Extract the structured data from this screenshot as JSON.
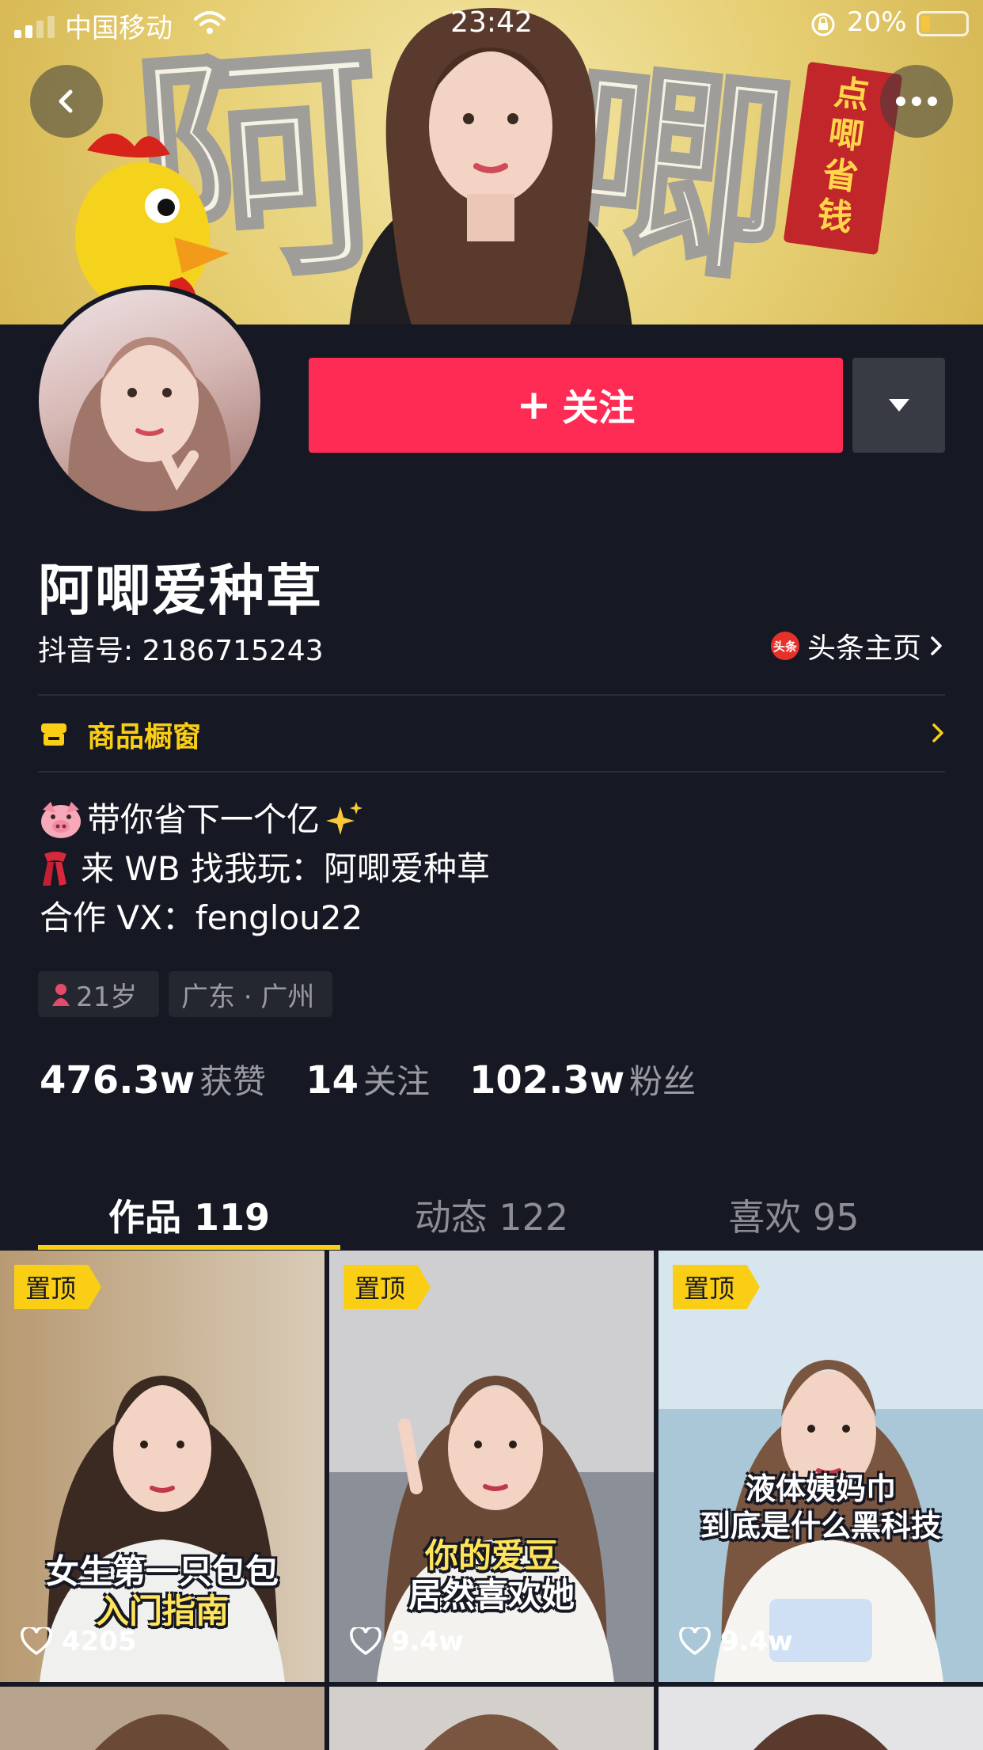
{
  "status_bar": {
    "carrier": "中国移动",
    "time": "23:42",
    "battery": "20%",
    "battery_level": 0.2
  },
  "banner": {
    "chars": [
      "阿",
      "唧"
    ],
    "tag_text": "点唧省钱"
  },
  "profile": {
    "name": "阿唧爱种草",
    "douyin_id": "抖音号: 2186715243",
    "toutiao_label": "头条主页",
    "toutiao_icon_text": "头条",
    "follow_label": "关注",
    "shop_label": "商品橱窗"
  },
  "bio": {
    "line1": "带你省下一个亿",
    "line2": "来 WB 找我玩：阿唧爱种草",
    "line3": "合作 VX：fenglou22"
  },
  "tags": {
    "age": "21岁",
    "location": "广东 · 广州"
  },
  "stats": [
    {
      "value": "476.3w",
      "label": "获赞"
    },
    {
      "value": "14",
      "label": "关注"
    },
    {
      "value": "102.3w",
      "label": "粉丝"
    }
  ],
  "tabs": [
    {
      "label": "作品 119"
    },
    {
      "label": "动态 122"
    },
    {
      "label": "喜欢 95"
    }
  ],
  "videos": [
    {
      "badge": "置顶",
      "caption1": "女生第一只包包",
      "caption2": "入门指南",
      "likes": "4205"
    },
    {
      "badge": "置顶",
      "caption1": "你的爱豆",
      "caption2": "居然喜欢她",
      "likes": "9.4w"
    },
    {
      "badge": "置顶",
      "caption1": "液体姨妈巾",
      "caption2": "到底是什么黑科技",
      "likes": "9.4w"
    }
  ],
  "colors": {
    "accent": "#fe2c55",
    "highlight": "#face15",
    "background": "#161823"
  }
}
